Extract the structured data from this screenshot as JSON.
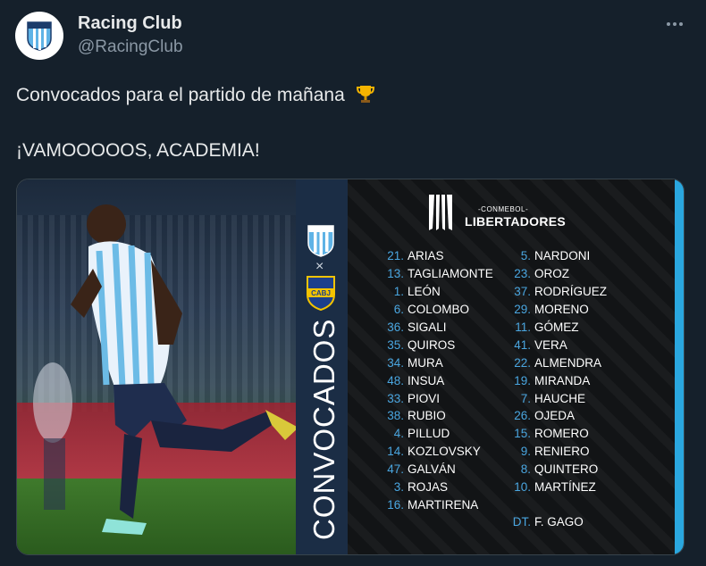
{
  "tweet": {
    "display_name": "Racing Club",
    "handle": "@RacingClub",
    "line1": "Convocados para el partido de mañana",
    "trophy_icon": "trophy-icon",
    "line2": "¡VAMOOOOOS, ACADEMIA!"
  },
  "media": {
    "vertical_title": "CONVOCADOS",
    "vs_symbol": "×",
    "competition_sub": "-CONMEBOL-",
    "competition_title": "LIBERTADORES",
    "accent_color": "#2aa7df",
    "number_color": "#4aa6e0",
    "players_left": [
      {
        "num": "21.",
        "name": "ARIAS"
      },
      {
        "num": "13.",
        "name": "TAGLIAMONTE"
      },
      {
        "num": "1.",
        "name": "LEÓN"
      },
      {
        "num": "6.",
        "name": "COLOMBO"
      },
      {
        "num": "36.",
        "name": "SIGALI"
      },
      {
        "num": "35.",
        "name": "QUIROS"
      },
      {
        "num": "34.",
        "name": "MURA"
      },
      {
        "num": "48.",
        "name": "INSUA"
      },
      {
        "num": "33.",
        "name": "PIOVI"
      },
      {
        "num": "38.",
        "name": "RUBIO"
      },
      {
        "num": "4.",
        "name": "PILLUD"
      },
      {
        "num": "14.",
        "name": "KOZLOVSKY"
      },
      {
        "num": "47.",
        "name": "GALVÁN"
      },
      {
        "num": "3.",
        "name": "ROJAS"
      },
      {
        "num": "16.",
        "name": "MARTIRENA"
      }
    ],
    "players_right": [
      {
        "num": "5.",
        "name": "NARDONI"
      },
      {
        "num": "23.",
        "name": "OROZ"
      },
      {
        "num": "37.",
        "name": "RODRÍGUEZ"
      },
      {
        "num": "29.",
        "name": "MORENO"
      },
      {
        "num": "11.",
        "name": "GÓMEZ"
      },
      {
        "num": "41.",
        "name": "VERA"
      },
      {
        "num": "22.",
        "name": "ALMENDRA"
      },
      {
        "num": "19.",
        "name": "MIRANDA"
      },
      {
        "num": "7.",
        "name": "HAUCHE"
      },
      {
        "num": "26.",
        "name": "OJEDA"
      },
      {
        "num": "15.",
        "name": "ROMERO"
      },
      {
        "num": "9.",
        "name": "RENIERO"
      },
      {
        "num": "8.",
        "name": "QUINTERO"
      },
      {
        "num": "10.",
        "name": "MARTÍNEZ"
      }
    ],
    "coach": {
      "num": "DT.",
      "name": "F. GAGO"
    }
  }
}
